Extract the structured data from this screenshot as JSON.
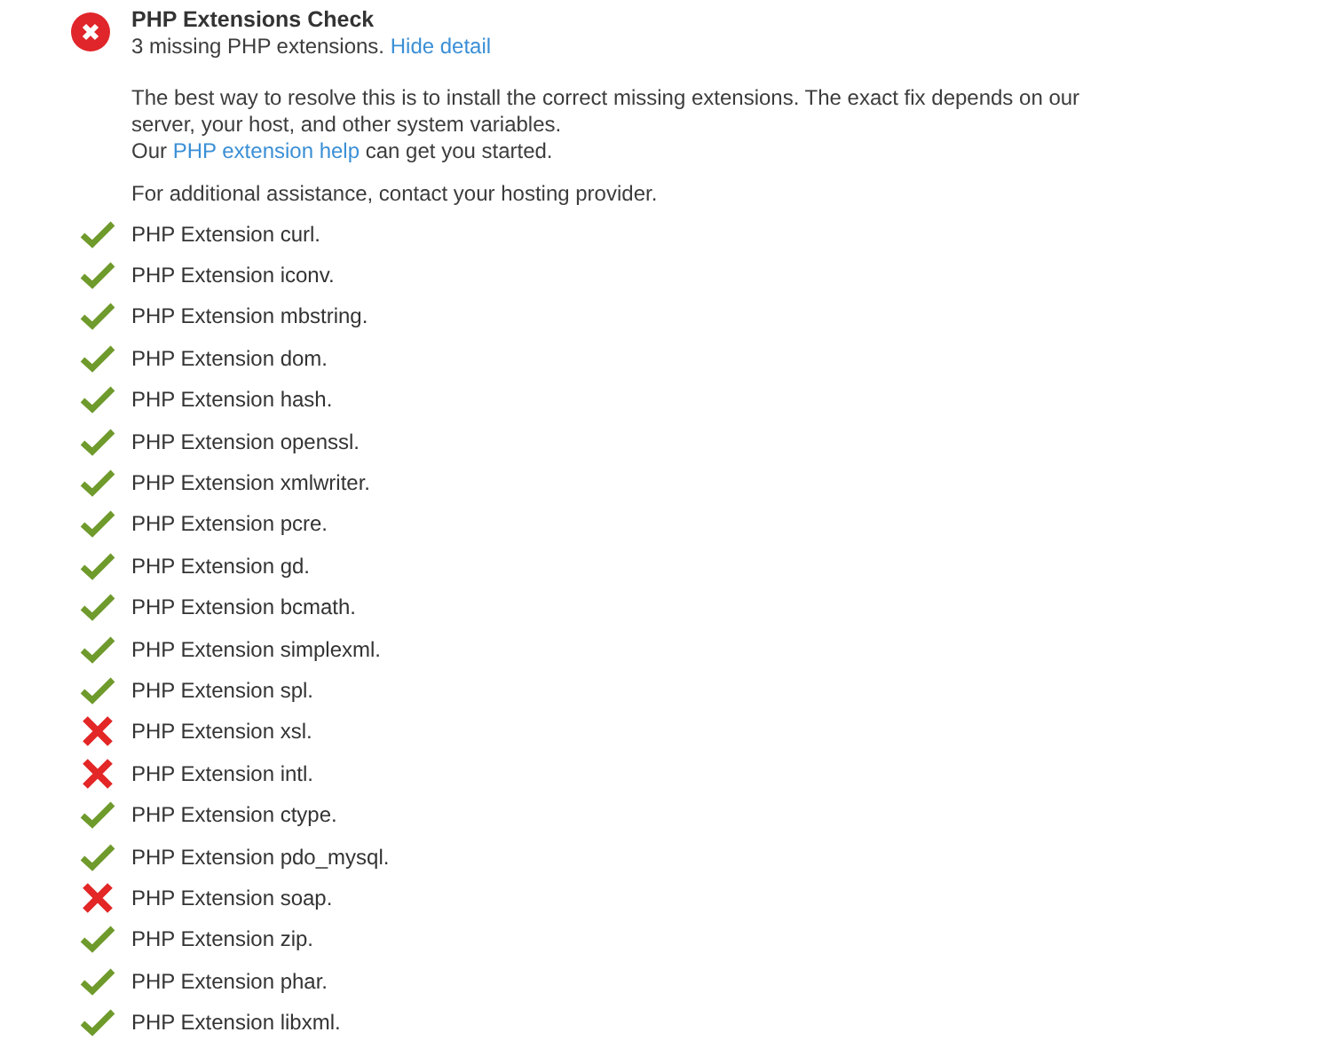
{
  "check": {
    "title": "PHP Extensions Check",
    "passed": false,
    "summary": "3 missing PHP extensions.",
    "toggle_link": "Hide detail"
  },
  "description": "The best way to resolve this is to install the correct missing extensions. The exact fix depends on our server, your host, and other system variables.",
  "help_line": {
    "before": "Our ",
    "link": "PHP extension help",
    "after": " can get you started."
  },
  "assistance": "For additional assistance, contact your hosting provider.",
  "extensions": [
    {
      "label": "PHP Extension curl.",
      "installed": true
    },
    {
      "label": "PHP Extension iconv.",
      "installed": true
    },
    {
      "label": "PHP Extension mbstring.",
      "installed": true
    },
    {
      "label": "PHP Extension dom.",
      "installed": true
    },
    {
      "label": "PHP Extension hash.",
      "installed": true
    },
    {
      "label": "PHP Extension openssl.",
      "installed": true
    },
    {
      "label": "PHP Extension xmlwriter.",
      "installed": true
    },
    {
      "label": "PHP Extension pcre.",
      "installed": true
    },
    {
      "label": "PHP Extension gd.",
      "installed": true
    },
    {
      "label": "PHP Extension bcmath.",
      "installed": true
    },
    {
      "label": "PHP Extension simplexml.",
      "installed": true
    },
    {
      "label": "PHP Extension spl.",
      "installed": true
    },
    {
      "label": "PHP Extension xsl.",
      "installed": false
    },
    {
      "label": "PHP Extension intl.",
      "installed": false
    },
    {
      "label": "PHP Extension ctype.",
      "installed": true
    },
    {
      "label": "PHP Extension pdo_mysql.",
      "installed": true
    },
    {
      "label": "PHP Extension soap.",
      "installed": false
    },
    {
      "label": "PHP Extension zip.",
      "installed": true
    },
    {
      "label": "PHP Extension phar.",
      "installed": true
    },
    {
      "label": "PHP Extension libxml.",
      "installed": true
    }
  ]
}
